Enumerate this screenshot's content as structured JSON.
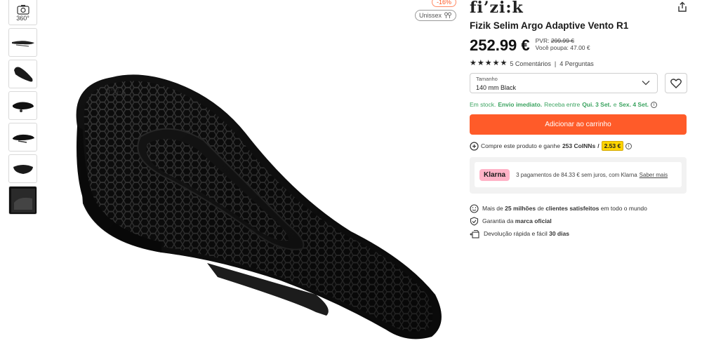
{
  "gallery": {
    "spin_label": "360°",
    "discount_badge": "-16%",
    "gender_badge": "Unissex"
  },
  "product": {
    "brand": "fi’zi:k",
    "title": "Fizik Selim Argo Adaptive Vento R1",
    "price": "252.99 €",
    "pvr_label": "PVR:",
    "pvr_value": "299.99 €",
    "savings": "Você poupa: 47.00 €",
    "rating_value": 5,
    "reviews": "5 Comentários",
    "questions": "4 Perguntas"
  },
  "size_select": {
    "label": "Tamanho",
    "value": "140 mm Black"
  },
  "stock": {
    "status": "Em stock.",
    "shipping": "Envio imediato.",
    "delivery_prefix": "Receba entre",
    "date_start": "Qui. 3 Set.",
    "and": "e",
    "date_end": "Sex. 4 Set."
  },
  "cart_button": "Adicionar ao carrinho",
  "coins": {
    "prefix": "Compre este produto e ganhe",
    "amount": "253 CoINNs",
    "slash": "/",
    "value": "2.53 €"
  },
  "klarna": {
    "logo": "Klarna",
    "text": "3 pagamentos de 84.33 € sem juros, com Klarna",
    "link": "Saber mais"
  },
  "benefits": [
    {
      "a": "Mais de",
      "b": "25 milhões",
      "c": "de",
      "d": "clientes satisfeitos",
      "e": "em todo o mundo"
    },
    {
      "a": "Garantia da",
      "b": "marca oficial"
    },
    {
      "a": "Devolução rápida e fácil",
      "b": "30 dias"
    }
  ],
  "colors": {
    "accent": "#ff5b29",
    "stock_green": "#3aa35f",
    "coin_yellow": "#ffd400",
    "klarna_pink": "#ffb3c7"
  }
}
